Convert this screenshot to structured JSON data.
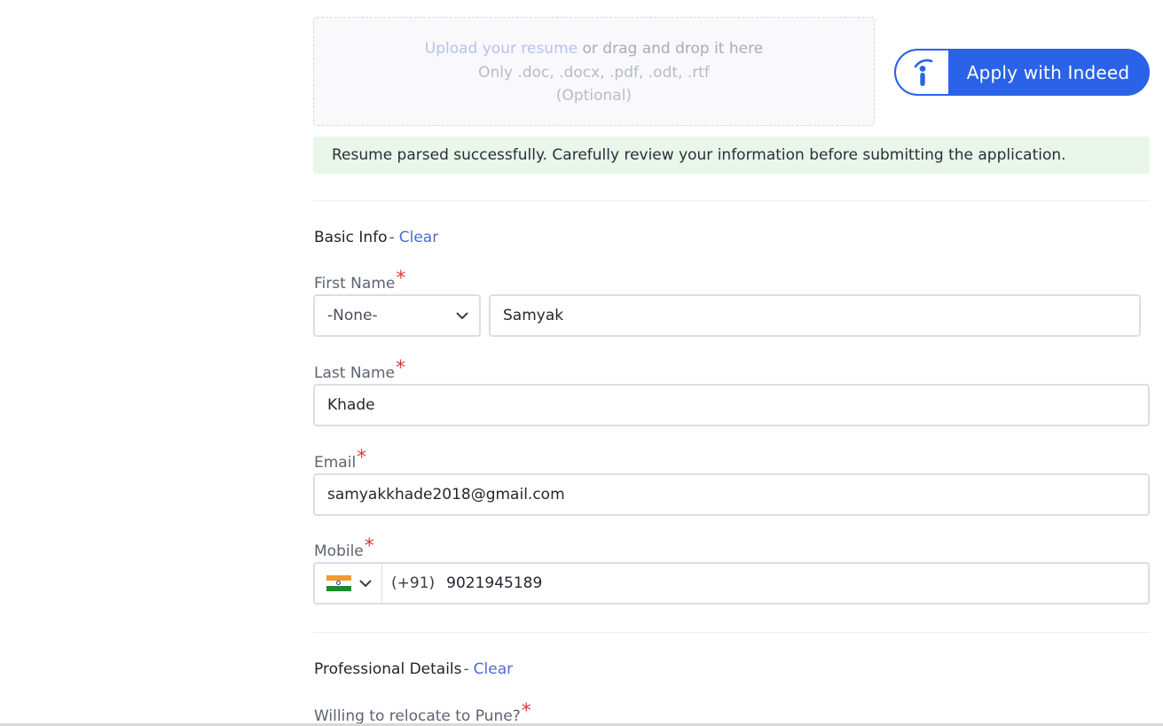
{
  "upload": {
    "link_text": "Upload your resume",
    "rest_text": " or drag and drop it here",
    "formats": "Only .doc, .docx, .pdf, .odt, .rtf",
    "optional": "(Optional)"
  },
  "indeed": {
    "label": "Apply with Indeed",
    "icon": "indeed-logo-icon"
  },
  "banner": {
    "text": "Resume parsed successfully. Carefully review your information before submitting the application."
  },
  "basic_info": {
    "title": "Basic Info",
    "dash": "-",
    "clear": "Clear",
    "required_mark": "*",
    "first_name": {
      "label": "First Name",
      "salutation": "-None-",
      "value": "Samyak"
    },
    "last_name": {
      "label": "Last Name",
      "value": "Khade"
    },
    "email": {
      "label": "Email",
      "value": "samyakkhade2018@gmail.com"
    },
    "mobile": {
      "label": "Mobile",
      "country_code": "(+91)",
      "value": "9021945189",
      "flag": "india-flag-icon"
    }
  },
  "professional": {
    "title": "Professional Details",
    "dash": "-",
    "clear": "Clear",
    "relocate_label": "Willing to relocate to Pune?"
  },
  "colors": {
    "accent": "#2a63e8",
    "link": "#5069d4",
    "required": "#e03a3a",
    "banner_bg": "#e9f6ea"
  }
}
